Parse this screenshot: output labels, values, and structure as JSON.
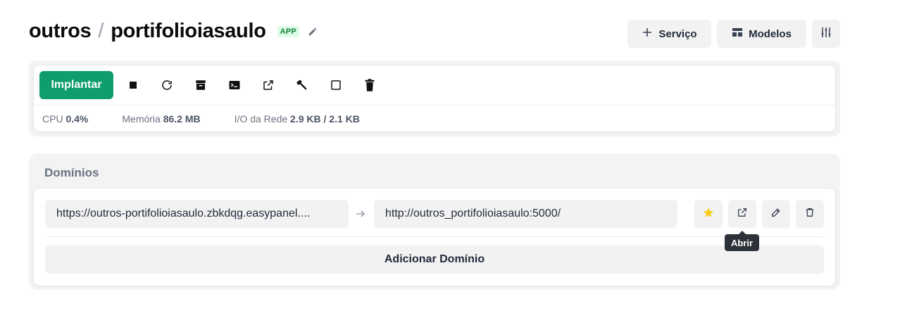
{
  "header": {
    "project": "outros",
    "separator": "/",
    "service": "portifolioiasaulo",
    "badge": "APP",
    "buttons": {
      "service": "Serviço",
      "templates": "Modelos"
    }
  },
  "toolbar": {
    "deploy_label": "Implantar",
    "icons": [
      "stop-icon",
      "restart-icon",
      "archive-icon",
      "terminal-icon",
      "external-link-icon",
      "build-hammer-icon",
      "square-icon",
      "trash-icon"
    ]
  },
  "stats": {
    "cpu_label": "CPU",
    "cpu_value": "0.4%",
    "memory_label": "Memória",
    "memory_value": "86.2 MB",
    "network_label": "I/O da Rede",
    "network_value": "2.9 KB / 2.1 KB"
  },
  "domains": {
    "title": "Domínios",
    "items": [
      {
        "source": "https://outros-portifolioiasaulo.zbkdqg.easypanel....",
        "destination": "http://outros_portifolioiasaulo:5000/"
      }
    ],
    "add_label": "Adicionar Domínio",
    "tooltip": "Abrir"
  },
  "colors": {
    "primary": "#0f9d6b",
    "badge_bg": "#dcfce7",
    "badge_text": "#15803d",
    "star": "#facc15",
    "tooltip_bg": "#2d3239"
  }
}
